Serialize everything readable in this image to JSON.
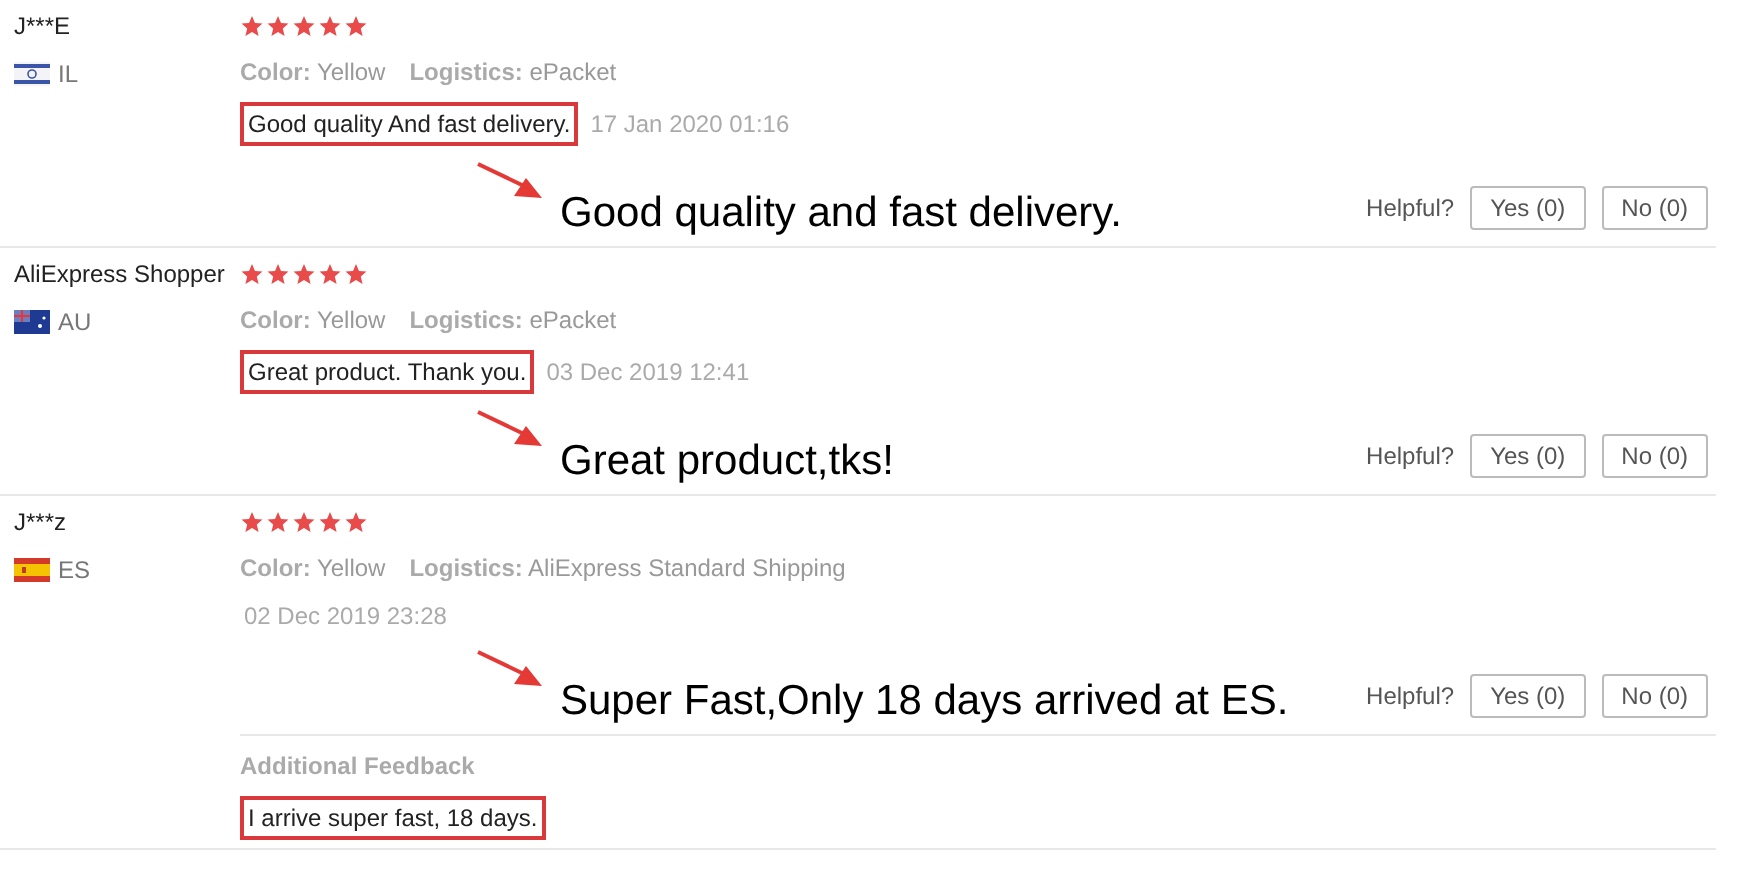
{
  "reviews": [
    {
      "name": "J***E",
      "kind": "il",
      "country": "IL",
      "stars": 5,
      "color_label": "Color:",
      "color_value": "Yellow",
      "logistics_label": "Logistics:",
      "logistics": "ePacket",
      "comment": "Good quality And fast delivery.",
      "comment_highlighted": true,
      "date": "17 Jan 2020 01:16",
      "annotation": "Good quality and fast delivery.",
      "helpful_label": "Helpful?",
      "yes": "Yes (0)",
      "no": "No (0)"
    },
    {
      "name": "AliExpress Shopper",
      "kind": "au",
      "country": "AU",
      "stars": 5,
      "color_label": "Color:",
      "color_value": "Yellow",
      "logistics_label": "Logistics:",
      "logistics": "ePacket",
      "comment": "Great product. Thank you.",
      "comment_highlighted": true,
      "date": "03 Dec 2019 12:41",
      "annotation": "Great product,tks!",
      "helpful_label": "Helpful?",
      "yes": "Yes (0)",
      "no": "No (0)"
    },
    {
      "name": "J***z",
      "kind": "es",
      "country": "ES",
      "stars": 5,
      "color_label": "Color:",
      "color_value": "Yellow",
      "logistics_label": "Logistics:",
      "logistics": "AliExpress Standard Shipping",
      "date": "02 Dec 2019 23:28",
      "annotation": "Super Fast,Only 18 days arrived at ES.",
      "helpful_label": "Helpful?",
      "yes": "Yes (0)",
      "no": "No (0)",
      "additional_title": "Additional Feedback",
      "additional": "I arrive super fast, 18 days.",
      "additional_highlighted": true
    }
  ]
}
